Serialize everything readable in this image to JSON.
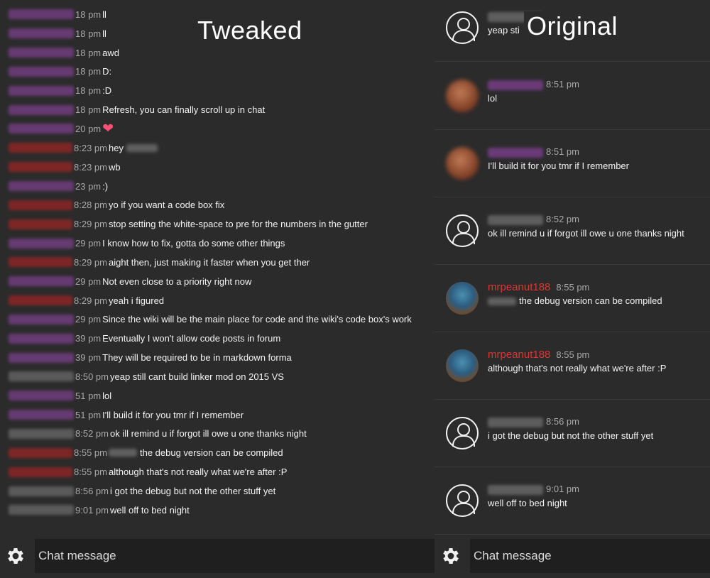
{
  "labels": {
    "tweaked": "Tweaked",
    "original": "Original"
  },
  "left_messages": [
    {
      "user": "purple",
      "time": "18 pm",
      "text": "ll"
    },
    {
      "user": "purple",
      "time": "18 pm",
      "text": "ll"
    },
    {
      "user": "purple",
      "time": "18 pm",
      "text": "awd"
    },
    {
      "user": "purple",
      "time": "18 pm",
      "text": "D:"
    },
    {
      "user": "purple",
      "time": "18 pm",
      "text": ":D"
    },
    {
      "user": "purple",
      "time": "18 pm",
      "text": "Refresh, you can finally scroll up in chat"
    },
    {
      "user": "purple",
      "time": "20 pm",
      "text": "❤",
      "heart": true
    },
    {
      "user": "red",
      "time": "8:23 pm",
      "text": "hey",
      "trail_blur": true
    },
    {
      "user": "red",
      "time": "8:23 pm",
      "text": "wb"
    },
    {
      "user": "purple",
      "time": "23 pm",
      "text": ":)"
    },
    {
      "user": "red",
      "time": "8:28 pm",
      "text": "yo if you want a code box fix"
    },
    {
      "user": "red",
      "time": "8:29 pm",
      "text": "stop setting the white-space to pre for the numbers in the gutter"
    },
    {
      "user": "purple",
      "time": "29 pm",
      "text": "I know how to fix, gotta do some other things"
    },
    {
      "user": "red",
      "time": "8:29 pm",
      "text": "aight then, just making it faster when you get ther"
    },
    {
      "user": "purple",
      "time": "29 pm",
      "text": "Not even close to a priority right now"
    },
    {
      "user": "red",
      "time": "8:29 pm",
      "text": "yeah i figured"
    },
    {
      "user": "purple",
      "time": "29 pm",
      "text": "Since the wiki will be the main place for code and the wiki's code box's work"
    },
    {
      "user": "purple",
      "time": "39 pm",
      "text": "Eventually I won't allow code posts in forum"
    },
    {
      "user": "purple",
      "time": "39 pm",
      "text": "They will be required to be in markdown forma"
    },
    {
      "user": "gray",
      "time": "8:50 pm",
      "text": "yeap still cant build linker mod on 2015 VS"
    },
    {
      "user": "purple",
      "time": "51 pm",
      "text": "lol"
    },
    {
      "user": "purple",
      "time": "51 pm",
      "text": "I'll build it for you tmr if I remember"
    },
    {
      "user": "gray",
      "time": "8:52 pm",
      "text": "ok ill remind u if forgot ill owe u one thanks night"
    },
    {
      "user": "red",
      "time": "8:55 pm",
      "text": "the debug version can be compiled",
      "lead_blur": true
    },
    {
      "user": "red",
      "time": "8:55 pm",
      "text": "although that's not really what we're after :P"
    },
    {
      "user": "gray",
      "time": "8:56 pm",
      "text": "i got the debug but not the other stuff yet"
    },
    {
      "user": "gray",
      "time": "9:01 pm",
      "text": "well off to bed night"
    }
  ],
  "right_messages": [
    {
      "avatar": "outline",
      "name": "",
      "name_color": "gray",
      "time": "",
      "text": "yeap sti            n 2015 VS"
    },
    {
      "avatar": "blurred",
      "name": "",
      "name_color": "purple",
      "time": "8:51 pm",
      "text": "lol"
    },
    {
      "avatar": "blurred",
      "name": "",
      "name_color": "purple",
      "time": "8:51 pm",
      "text": "I'll build it for you tmr if I remember"
    },
    {
      "avatar": "outline",
      "name": "",
      "name_color": "gray",
      "time": "8:52 pm",
      "text": "ok ill remind u if forgot ill owe u one thanks night"
    },
    {
      "avatar": "peanut",
      "name": "mrpeanut188",
      "name_color": "red",
      "time": "8:55 pm",
      "text": "the debug version can be compiled",
      "lead_blur": true
    },
    {
      "avatar": "peanut",
      "name": "mrpeanut188",
      "name_color": "red",
      "time": "8:55 pm",
      "text": "although that's not really what we're after :P"
    },
    {
      "avatar": "outline",
      "name": "",
      "name_color": "gray",
      "time": "8:56 pm",
      "text": "i got the debug but not the other stuff yet"
    },
    {
      "avatar": "outline",
      "name": "",
      "name_color": "gray",
      "time": "9:01 pm",
      "text": "well off to bed night"
    }
  ],
  "chat": {
    "placeholder_left": "Chat message",
    "placeholder_right": "Chat message"
  },
  "icons": {
    "settings": "gear-icon",
    "user": "user-icon"
  }
}
